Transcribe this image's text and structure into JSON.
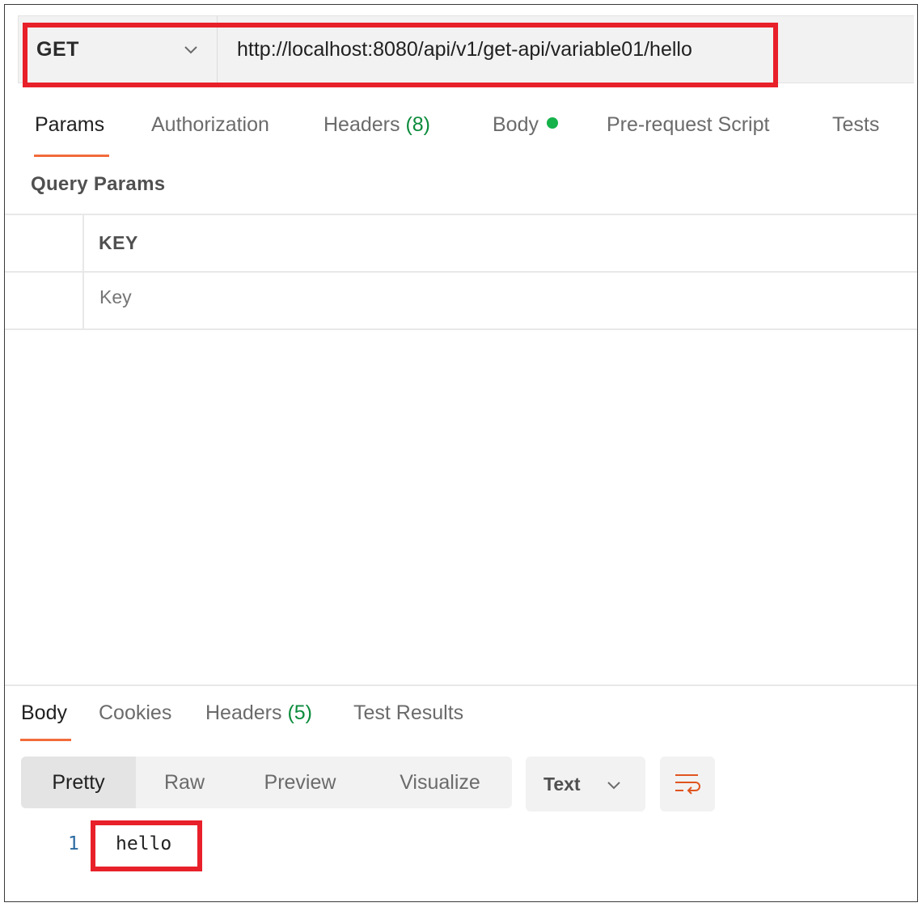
{
  "request": {
    "method": "GET",
    "url": "http://localhost:8080/api/v1/get-api/variable01/hello"
  },
  "request_tabs": {
    "params": "Params",
    "authorization": "Authorization",
    "headers": "Headers",
    "headers_count": "(8)",
    "body": "Body",
    "prerequest": "Pre-request Script",
    "tests": "Tests"
  },
  "query_params": {
    "title": "Query Params",
    "key_header": "KEY",
    "key_placeholder": "Key"
  },
  "response_tabs": {
    "body": "Body",
    "cookies": "Cookies",
    "headers": "Headers",
    "headers_count": "(5)",
    "test_results": "Test Results"
  },
  "format_tabs": {
    "pretty": "Pretty",
    "raw": "Raw",
    "preview": "Preview",
    "visualize": "Visualize"
  },
  "response_format": "Text",
  "response_body": {
    "line_number": "1",
    "text": "hello"
  },
  "colors": {
    "accent": "#f26b3a",
    "highlight": "#e8202a",
    "count_green": "#0c8b3c",
    "status_dot": "#16b24a"
  },
  "icons": {
    "method_dropdown": "chevron-down-icon",
    "format_dropdown": "chevron-down-icon",
    "wrap": "wrap-lines-icon",
    "body_indicator": "green-dot-icon"
  }
}
